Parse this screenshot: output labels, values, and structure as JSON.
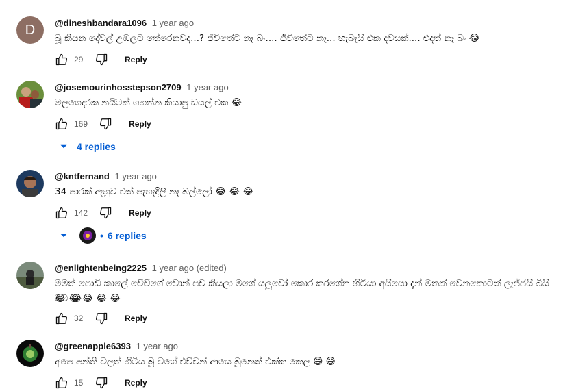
{
  "comments": [
    {
      "author": "@dineshbandara1096",
      "time": "1 year ago",
      "avatar_letter": "D",
      "text": "බූ කියන දේවල් උඹලට තේරෙනවද...? ජීවිතේට නෑ බං.... ජීවිතේට නෑ... හැබැයි එක දවසක්.... එදත් නෑ බං 😂",
      "likes": "29",
      "reply_label": "Reply"
    },
    {
      "author": "@josemourinhosstepson2709",
      "time": "1 year ago",
      "text": "මලගෙදරක නයිටක් ගහන්න කියාපු ඩයල් එක 😂",
      "likes": "169",
      "reply_label": "Reply",
      "replies_label": "4 replies"
    },
    {
      "author": "@kntfernand",
      "time": "1 year ago",
      "text": "34 පාරක් ඇහුව එත් පැහැදිලි නෑ බල්ලෝ 😂 😂 😂",
      "likes": "142",
      "reply_label": "Reply",
      "replies_label": "6 replies",
      "replies_dot": "•"
    },
    {
      "author": "@enlightenbeing2225",
      "time": "1 year ago (edited)",
      "text_line1": "මමත් පොඩි කාලේ චේච්ගේ වොන් පච කියලා මගේ යලුවෝ කොර කරගේන හිටියා අයියො දැන් මතක් වෙනකොටත් ලැජ්ජයි බියි මට  😂",
      "text_line2": "😂 😂 😂 😂 😂",
      "likes": "32",
      "reply_label": "Reply"
    },
    {
      "author": "@greenapple6393",
      "time": "1 year ago",
      "text": "අපෙ පන්ති වලත් හිටිය බූ වගේ එච්චන් ආයෙ බූනෙත් එක්ක කෙල 😅 😅",
      "likes": "15",
      "reply_label": "Reply"
    }
  ],
  "icons": {
    "like": "thumbs-up-icon",
    "dislike": "thumbs-down-icon",
    "replies_caret": "caret-down-icon"
  },
  "colors": {
    "link": "#065fd4",
    "meta": "#606060",
    "text": "#0f0f0f"
  }
}
